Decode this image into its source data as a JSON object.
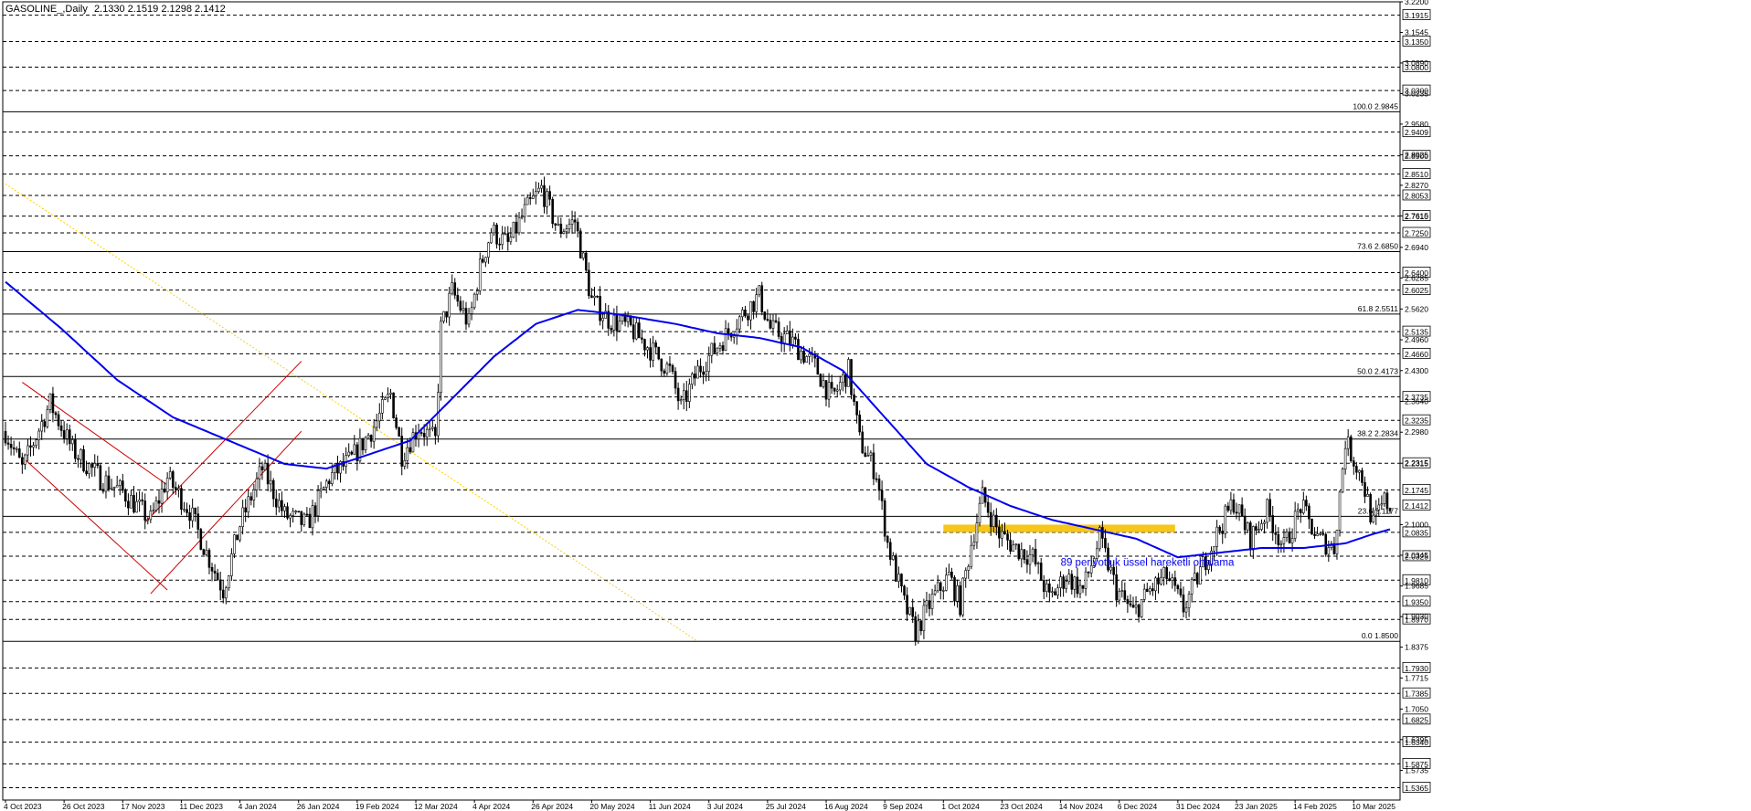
{
  "header": {
    "symbol": "GASOLINE_,Daily",
    "ohlc": "2.1330 2.1519 2.1298 2.1412"
  },
  "chart_data": {
    "type": "candlestick",
    "ylim": [
      1.51,
      3.22
    ],
    "y_tick_labels": [
      3.22,
      3.1545,
      3.089,
      3.0235,
      2.958,
      2.8925,
      2.827,
      2.7615,
      2.694,
      2.6285,
      2.562,
      2.496,
      2.43,
      2.364,
      2.298,
      2.2315,
      2.1,
      2.0345,
      1.9685,
      1.903,
      1.8375,
      1.7715,
      1.705,
      1.6395,
      1.5735
    ],
    "y_tick_text": [
      "3.2200",
      "3.1545",
      "3.0890",
      "3.0235",
      "2.9580",
      "2.8925",
      "2.8270",
      "2.7615",
      "2.6940",
      "2.6285",
      "2.5620",
      "2.4960",
      "2.4300",
      "2.3640",
      "2.2980",
      "2.2315",
      "2.1000",
      "2.0345",
      "1.9685",
      "1.9030",
      "1.8375",
      "1.7715",
      "1.7050",
      "1.6395",
      "1.5735"
    ],
    "horizontal_levels": [
      {
        "value": 3.1915,
        "label": "3.1915"
      },
      {
        "value": 3.135,
        "label": "3.1350"
      },
      {
        "value": 3.08,
        "label": "3.0800"
      },
      {
        "value": 3.03,
        "label": "3.0300"
      },
      {
        "value": 2.9409,
        "label": "2.9409"
      },
      {
        "value": 2.89,
        "label": "2.8900"
      },
      {
        "value": 2.851,
        "label": "2.8510"
      },
      {
        "value": 2.8053,
        "label": "2.8053"
      },
      {
        "value": 2.761,
        "label": "2.7610"
      },
      {
        "value": 2.725,
        "label": "2.7250"
      },
      {
        "value": 2.64,
        "label": "2.6400"
      },
      {
        "value": 2.6025,
        "label": "2.6025"
      },
      {
        "value": 2.5135,
        "label": "2.5135"
      },
      {
        "value": 2.466,
        "label": "2.4660"
      },
      {
        "value": 2.3735,
        "label": "2.3735"
      },
      {
        "value": 2.3235,
        "label": "2.3235"
      },
      {
        "value": 2.2315,
        "label": "2.2315"
      },
      {
        "value": 2.1745,
        "label": "2.1745"
      },
      {
        "value": 2.0835,
        "label": "2.0835"
      },
      {
        "value": 2.0325,
        "label": "2.0325"
      },
      {
        "value": 1.981,
        "label": "1.9810"
      },
      {
        "value": 1.935,
        "label": "1.9350"
      },
      {
        "value": 1.897,
        "label": "1.8970"
      },
      {
        "value": 1.793,
        "label": "1.7930"
      },
      {
        "value": 1.7385,
        "label": "1.7385"
      },
      {
        "value": 1.6825,
        "label": "1.6825"
      },
      {
        "value": 1.634,
        "label": "1.6340"
      },
      {
        "value": 1.5875,
        "label": "1.5875"
      },
      {
        "value": 1.5365,
        "label": "1.5365"
      }
    ],
    "current_price": {
      "value": 2.1412,
      "label": "2.1412"
    },
    "fibonacci": [
      {
        "value": 2.9845,
        "label": "100.0 2.9845"
      },
      {
        "value": 2.685,
        "label": "73.6 2.6850"
      },
      {
        "value": 2.5511,
        "label": "61.8 2.5511"
      },
      {
        "value": 2.4173,
        "label": "50.0 2.4173"
      },
      {
        "value": 2.2834,
        "label": "38.2 2.2834"
      },
      {
        "value": 2.1177,
        "label": "23.6 2.1177"
      },
      {
        "value": 1.85,
        "label": "0.0 1.8500"
      }
    ],
    "x_tick_labels": [
      "4 Oct 2023",
      "26 Oct 2023",
      "17 Nov 2023",
      "11 Dec 2023",
      "4 Jan 2024",
      "26 Jan 2024",
      "19 Feb 2024",
      "12 Mar 2024",
      "4 Apr 2024",
      "26 Apr 2024",
      "20 May 2024",
      "11 Jun 2024",
      "3 Jul 2024",
      "25 Jul 2024",
      "16 Aug 2024",
      "9 Sep 2024",
      "1 Oct 2024",
      "23 Oct 2024",
      "14 Nov 2024",
      "6 Dec 2024",
      "31 Dec 2024",
      "23 Jan 2025",
      "14 Feb 2025",
      "10 Mar 2025"
    ],
    "price_path": [
      [
        0,
        2.3
      ],
      [
        6,
        2.22
      ],
      [
        16,
        2.36
      ],
      [
        24,
        2.26
      ],
      [
        34,
        2.2
      ],
      [
        42,
        2.17
      ],
      [
        52,
        2.11
      ],
      [
        58,
        2.2
      ],
      [
        66,
        2.13
      ],
      [
        72,
        2.04
      ],
      [
        78,
        1.96
      ],
      [
        84,
        2.1
      ],
      [
        92,
        2.22
      ],
      [
        100,
        2.12
      ],
      [
        108,
        2.1
      ],
      [
        116,
        2.2
      ],
      [
        124,
        2.24
      ],
      [
        132,
        2.31
      ],
      [
        138,
        2.38
      ],
      [
        142,
        2.25
      ],
      [
        148,
        2.31
      ],
      [
        154,
        2.28
      ],
      [
        156,
        2.52
      ],
      [
        160,
        2.6
      ],
      [
        166,
        2.53
      ],
      [
        170,
        2.65
      ],
      [
        174,
        2.73
      ],
      [
        180,
        2.7
      ],
      [
        186,
        2.77
      ],
      [
        192,
        2.82
      ],
      [
        198,
        2.73
      ],
      [
        204,
        2.75
      ],
      [
        210,
        2.58
      ],
      [
        216,
        2.54
      ],
      [
        224,
        2.52
      ],
      [
        232,
        2.47
      ],
      [
        238,
        2.43
      ],
      [
        242,
        2.35
      ],
      [
        248,
        2.43
      ],
      [
        256,
        2.49
      ],
      [
        264,
        2.55
      ],
      [
        270,
        2.59
      ],
      [
        274,
        2.52
      ],
      [
        282,
        2.49
      ],
      [
        290,
        2.44
      ],
      [
        296,
        2.37
      ],
      [
        302,
        2.43
      ],
      [
        306,
        2.28
      ],
      [
        312,
        2.21
      ],
      [
        316,
        2.06
      ],
      [
        322,
        1.93
      ],
      [
        326,
        1.87
      ],
      [
        332,
        1.94
      ],
      [
        338,
        1.99
      ],
      [
        342,
        1.93
      ],
      [
        346,
        2.06
      ],
      [
        350,
        2.16
      ],
      [
        356,
        2.08
      ],
      [
        362,
        2.05
      ],
      [
        368,
        2.03
      ],
      [
        374,
        1.94
      ],
      [
        380,
        1.99
      ],
      [
        386,
        1.96
      ],
      [
        392,
        2.07
      ],
      [
        398,
        1.96
      ],
      [
        404,
        1.91
      ],
      [
        410,
        1.96
      ],
      [
        416,
        1.99
      ],
      [
        422,
        1.92
      ],
      [
        428,
        2.0
      ],
      [
        434,
        2.08
      ],
      [
        440,
        2.15
      ],
      [
        446,
        2.07
      ],
      [
        452,
        2.13
      ],
      [
        458,
        2.05
      ],
      [
        464,
        2.14
      ],
      [
        470,
        2.07
      ],
      [
        476,
        2.05
      ],
      [
        480,
        2.28
      ],
      [
        486,
        2.2
      ],
      [
        490,
        2.1
      ],
      [
        494,
        2.15
      ],
      [
        496,
        2.14
      ]
    ],
    "ema_89_path": [
      [
        0,
        2.62
      ],
      [
        20,
        2.52
      ],
      [
        40,
        2.41
      ],
      [
        60,
        2.33
      ],
      [
        80,
        2.28
      ],
      [
        100,
        2.23
      ],
      [
        115,
        2.22
      ],
      [
        130,
        2.25
      ],
      [
        145,
        2.28
      ],
      [
        160,
        2.37
      ],
      [
        175,
        2.46
      ],
      [
        190,
        2.53
      ],
      [
        205,
        2.56
      ],
      [
        220,
        2.55
      ],
      [
        240,
        2.53
      ],
      [
        255,
        2.51
      ],
      [
        270,
        2.5
      ],
      [
        285,
        2.48
      ],
      [
        300,
        2.43
      ],
      [
        315,
        2.33
      ],
      [
        330,
        2.23
      ],
      [
        345,
        2.18
      ],
      [
        360,
        2.14
      ],
      [
        375,
        2.11
      ],
      [
        390,
        2.09
      ],
      [
        405,
        2.07
      ],
      [
        420,
        2.03
      ],
      [
        435,
        2.04
      ],
      [
        450,
        2.05
      ],
      [
        465,
        2.05
      ],
      [
        480,
        2.06
      ],
      [
        490,
        2.08
      ],
      [
        496,
        2.09
      ]
    ],
    "annotation": "89 periyotluk üssel hareketli ortalama",
    "highlight_zone": [
      2.0835,
      2.1
    ],
    "colors": {
      "candles": "#000000",
      "ema": "#0000ee",
      "channel": "#cc0000",
      "zone": "#f5c000",
      "fib": "#000000",
      "trend": "#ffd000"
    }
  }
}
